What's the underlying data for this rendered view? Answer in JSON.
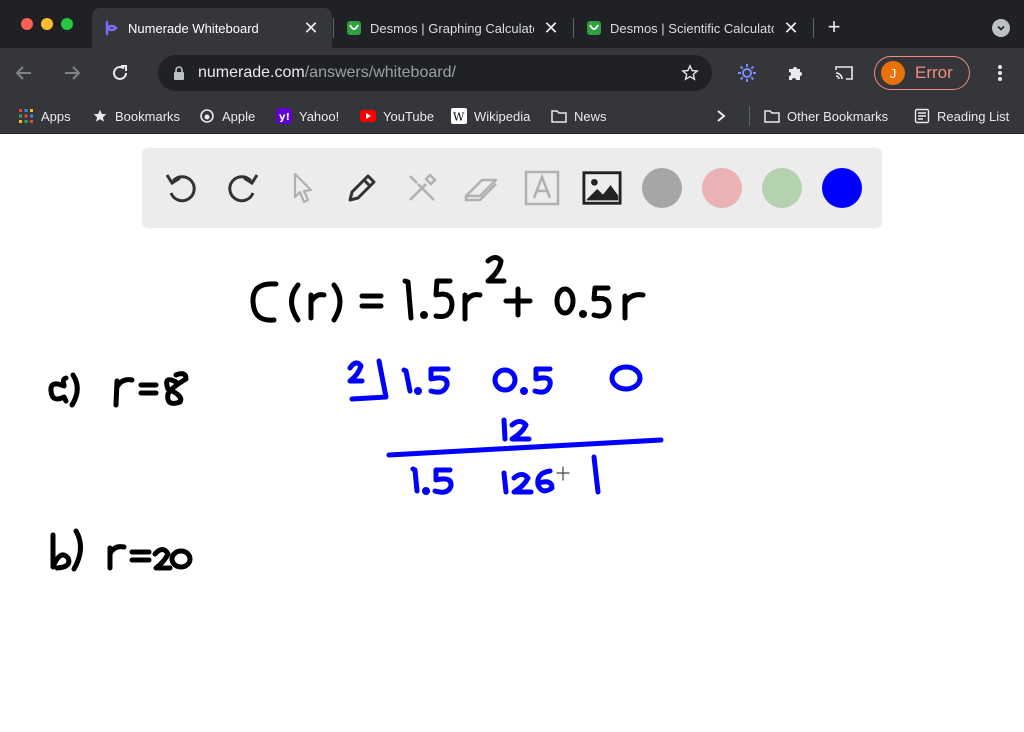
{
  "tabs": [
    {
      "title": "Numerade Whiteboard",
      "icon": "numerade-icon",
      "active": true
    },
    {
      "title": "Desmos | Graphing Calculator",
      "icon": "desmos-icon",
      "active": false
    },
    {
      "title": "Desmos | Scientific Calculator",
      "icon": "desmos-icon",
      "active": false
    }
  ],
  "toolbar": {
    "url_host": "numerade.com",
    "url_path": "/answers/whiteboard/",
    "profile_initial": "J",
    "profile_status": "Error"
  },
  "bookmarks": [
    {
      "label": "Apps",
      "icon": "apps-grid-icon"
    },
    {
      "label": "Bookmarks",
      "icon": "star-icon"
    },
    {
      "label": "Apple",
      "icon": "apple-icon"
    },
    {
      "label": "Yahoo!",
      "icon": "yahoo-icon"
    },
    {
      "label": "YouTube",
      "icon": "youtube-icon"
    },
    {
      "label": "Wikipedia",
      "icon": "wikipedia-icon"
    },
    {
      "label": "News",
      "icon": "folder-icon"
    }
  ],
  "bookmarks_right": [
    {
      "label": "Other Bookmarks",
      "icon": "folder-icon"
    },
    {
      "label": "Reading List",
      "icon": "reading-list-icon"
    }
  ],
  "whiteboard": {
    "tools": [
      "undo",
      "redo",
      "select",
      "pen",
      "tools",
      "eraser",
      "text",
      "image"
    ],
    "colors": [
      "#a6a6a6",
      "#eab2b2",
      "#b5d2b0",
      "#0000ff"
    ],
    "selected_color": "#0000ff"
  }
}
